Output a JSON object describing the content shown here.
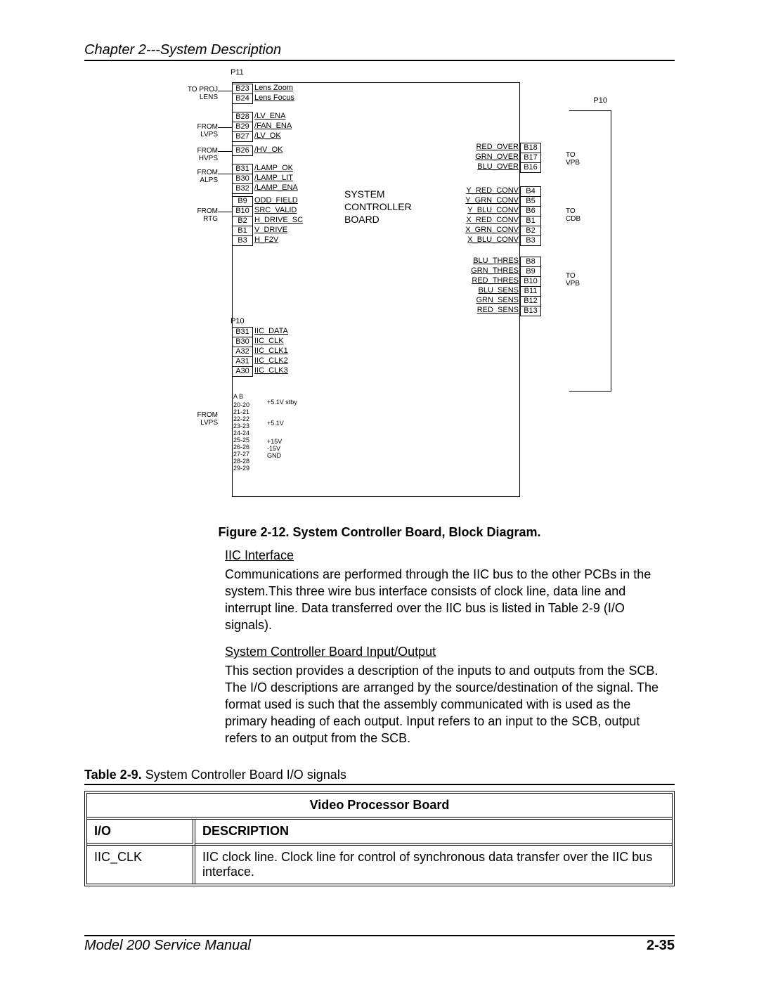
{
  "chapter_header": "Chapter 2---System Description",
  "figure_caption": "Figure 2-12.  System Controller Board, Block Diagram.",
  "section_iic_head": "IIC Interface",
  "section_iic_body": "Communications are performed through the IIC bus to the other PCBs in the system.This three wire bus interface consists of clock line, data line and interrupt line. Data transferred over the IIC bus is listed in Table 2-9 (I/O signals).",
  "section_io_head": "System Controller Board Input/Output",
  "section_io_body": "This section provides a description of the inputs to and outputs from the SCB. The I/O descriptions are arranged by the source/destination of the signal. The format used is such that the assembly communicated with is used as the primary heading of each output. Input refers to an input to the SCB, output refers to an output from the SCB.",
  "table_caption_prefix": "Table 2-9.",
  "table_caption_body": "  System Controller Board I/O signals",
  "table_section": "Video Processor Board",
  "table_col_io": "I/O",
  "table_col_desc": "DESCRIPTION",
  "table_row1_io": "IIC_CLK",
  "table_row1_desc": "IIC clock line. Clock line for control of synchronous data transfer over the IIC bus interface.",
  "footer_left": "Model 200 Service Manual",
  "footer_right": "2-35",
  "diag": {
    "p11": "P11",
    "p10": "P10",
    "scb_title1": "SYSTEM",
    "scb_title2": "CONTROLLER",
    "scb_title3": "BOARD",
    "side_proj": "TO PROJ\nLENS",
    "side_lvps": "FROM\nLVPS",
    "side_hvps": "FROM\nHVPS",
    "side_alps": "FROM\nALPS",
    "side_rtg": "FROM\nRTG",
    "side_lvps2": "FROM\nLVPS",
    "side_to_vpb": "TO\nVPB",
    "side_to_cdb": "TO\nCDB",
    "side_to_vpb2": "TO\nVPB",
    "pins_left_a": [
      {
        "pin": "B23",
        "sig": "Lens Zoom"
      },
      {
        "pin": "B24",
        "sig": "Lens Focus"
      }
    ],
    "pins_left_b": [
      {
        "pin": "B28",
        "sig": "/LV_ENA"
      },
      {
        "pin": "B29",
        "sig": "/FAN_ENA"
      },
      {
        "pin": "B27",
        "sig": "/LV_OK"
      }
    ],
    "pins_left_c": [
      {
        "pin": "B26",
        "sig": "/HV_OK"
      }
    ],
    "pins_left_d": [
      {
        "pin": "B31",
        "sig": "/LAMP_OK"
      },
      {
        "pin": "B30",
        "sig": "/LAMP_LIT"
      },
      {
        "pin": "B32",
        "sig": "/LAMP_ENA"
      }
    ],
    "pins_left_e": [
      {
        "pin": "B9",
        "sig": "ODD_FIELD"
      },
      {
        "pin": "B10",
        "sig": "SRC_VALID"
      },
      {
        "pin": "B2",
        "sig": "H_DRIVE_SC"
      },
      {
        "pin": "B1",
        "sig": "V_DRIVE"
      },
      {
        "pin": "B3",
        "sig": "H_F2V"
      }
    ],
    "pins_left_f": [
      {
        "pin": "B31",
        "sig": "IIC_DATA"
      },
      {
        "pin": "B30",
        "sig": "IIC_CLK"
      },
      {
        "pin": "A32",
        "sig": "IIC_CLK1"
      },
      {
        "pin": "A31",
        "sig": "IIC_CLK2"
      },
      {
        "pin": "A30",
        "sig": "IIC_CLK3"
      }
    ],
    "pins_right_a": [
      {
        "pin": "B18",
        "sig": "RED_OVER"
      },
      {
        "pin": "B17",
        "sig": "GRN_OVER"
      },
      {
        "pin": "B16",
        "sig": "BLU_OVER"
      }
    ],
    "pins_right_b": [
      {
        "pin": "B4",
        "sig": "Y_RED_CONV"
      },
      {
        "pin": "B5",
        "sig": "Y_GRN_CONV"
      },
      {
        "pin": "B6",
        "sig": "Y_BLU_CONV"
      },
      {
        "pin": "B1",
        "sig": "X_RED_CONV"
      },
      {
        "pin": "B2",
        "sig": "X_GRN_CONV"
      },
      {
        "pin": "B3",
        "sig": "X_BLU_CONV"
      }
    ],
    "pins_right_c": [
      {
        "pin": "B8",
        "sig": "BLU_THRES"
      },
      {
        "pin": "B9",
        "sig": "GRN_THRES"
      },
      {
        "pin": "B10",
        "sig": "RED_THRES"
      },
      {
        "pin": "B11",
        "sig": "BLU_SENS"
      },
      {
        "pin": "B12",
        "sig": "GRN_SENS"
      },
      {
        "pin": "B13",
        "sig": "RED_SENS"
      }
    ],
    "power": {
      "ab": "A   B",
      "rows": [
        "20-20",
        "21-21",
        "22-22",
        "23-23",
        "24-24",
        "25-25",
        "26-26",
        "27-27",
        "28-28",
        "29-29"
      ],
      "v1": "+5.1V stby",
      "v2": "+5.1V",
      "v3": "+15V",
      "v4": "-15V",
      "v5": "GND"
    }
  }
}
